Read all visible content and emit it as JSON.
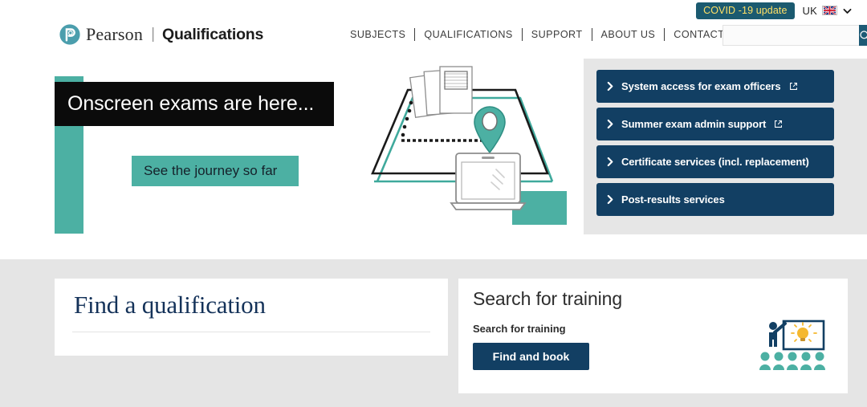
{
  "utility": {
    "covid_badge": "COVID -19 update",
    "locale_label": "UK",
    "flag_icon": "uk-flag-icon",
    "chevron_icon": "chevron-down-icon"
  },
  "header": {
    "brand_mark_icon": "pearson-p-logo-icon",
    "brand_word": "Pearson",
    "brand_separator": "|",
    "brand_sub": "Qualifications",
    "nav": [
      {
        "label": "SUBJECTS"
      },
      {
        "label": "QUALIFICATIONS"
      },
      {
        "label": "SUPPORT"
      },
      {
        "label": "ABOUT US"
      },
      {
        "label": "CONTACT US"
      }
    ],
    "search": {
      "value": "",
      "placeholder": "",
      "button_icon": "search-icon"
    }
  },
  "hero": {
    "banner_text": "Onscreen exams are here...",
    "cta_label": "See the journey so far",
    "illustration_icon": "onscreen-exams-journey-illustration"
  },
  "quicklinks": [
    {
      "label": "System access for exam officers",
      "chevron_icon": "chevron-right-icon",
      "external": true,
      "external_icon": "external-link-icon"
    },
    {
      "label": "Summer exam admin support",
      "chevron_icon": "chevron-right-icon",
      "external": true,
      "external_icon": "external-link-icon"
    },
    {
      "label": "Certificate services (incl. replacement)",
      "chevron_icon": "chevron-right-icon",
      "external": false
    },
    {
      "label": "Post-results services",
      "chevron_icon": "chevron-right-icon",
      "external": false
    }
  ],
  "find_card": {
    "title": "Find a qualification"
  },
  "training_card": {
    "title": "Search for training",
    "subtitle": "Search for training",
    "button_label": "Find and book",
    "illustration_icon": "training-presentation-illustration"
  },
  "colors": {
    "navy": "#123f63",
    "teal": "#4cb0a3",
    "covid_badge_bg": "#1b5a70",
    "covid_badge_text": "#ffe066",
    "search_button": "#1d5a75",
    "section_bg": "#e5e5e5",
    "panel_bg": "#e6e6e6",
    "banner_bg": "#0b0b0b",
    "serif_heading": "#143259"
  }
}
